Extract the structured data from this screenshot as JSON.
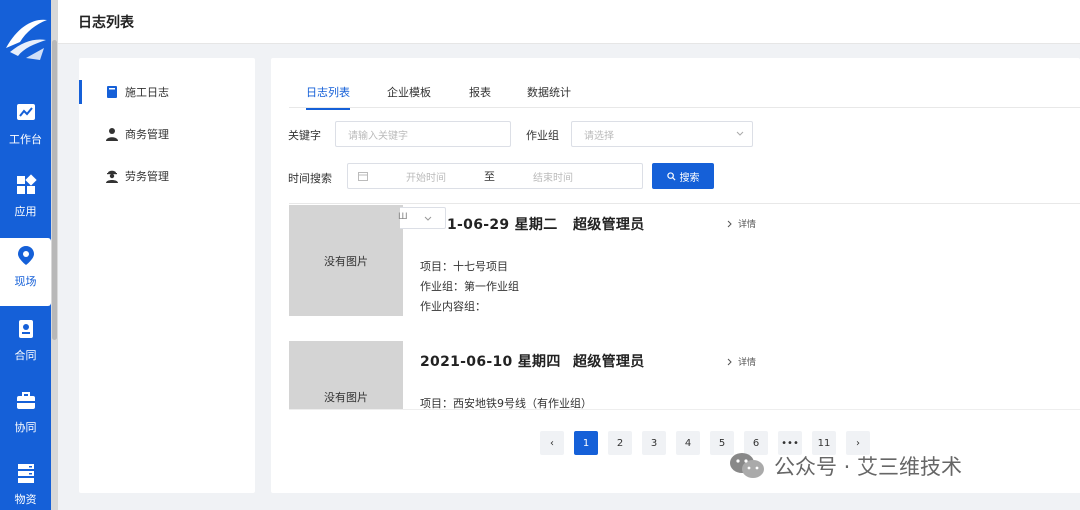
{
  "header": {
    "title": "日志列表"
  },
  "nav": {
    "items": [
      {
        "label": "工作台",
        "icon": "chart-icon"
      },
      {
        "label": "应用",
        "icon": "apps-icon"
      },
      {
        "label": "现场",
        "icon": "location-pin-icon"
      },
      {
        "label": "合同",
        "icon": "contract-icon"
      },
      {
        "label": "协同",
        "icon": "briefcase-icon"
      },
      {
        "label": "物资",
        "icon": "storage-icon"
      }
    ],
    "active": "现场"
  },
  "sidebar": {
    "items": [
      {
        "label": "施工日志",
        "icon": "book-icon"
      },
      {
        "label": "商务管理",
        "icon": "user-icon"
      },
      {
        "label": "劳务管理",
        "icon": "worker-icon"
      }
    ]
  },
  "tabs": [
    "日志列表",
    "企业模板",
    "报表",
    "数据统计"
  ],
  "filters": {
    "keyword_label": "关键字",
    "keyword_placeholder": "请输入关键字",
    "group_label": "作业组",
    "group_placeholder": "请选择",
    "time_label": "时间搜索",
    "start_placeholder": "开始时间",
    "to": "至",
    "end_placeholder": "结束时间",
    "search_button": "搜索"
  },
  "logs": [
    {
      "image": "没有图片",
      "select_fragment": "Ш",
      "date": "1-06-29  星期二",
      "user": "超级管理员",
      "detail": "详情",
      "project": "项目：十七号项目",
      "group": "作业组：第一作业组",
      "content": "作业内容组："
    },
    {
      "image": "没有图片",
      "date": "2021-06-10  星期四",
      "user": "超级管理员",
      "detail": "详情",
      "project": "项目：西安地铁9号线（有作业组）"
    }
  ],
  "pagination": {
    "prev": "‹",
    "pages": [
      "1",
      "2",
      "3",
      "4",
      "5",
      "6",
      "•••",
      "11"
    ],
    "next": "›",
    "current": "1"
  },
  "watermark": {
    "text": "公众号 · 艾三维技术"
  },
  "colors": {
    "primary": "#1560d8",
    "placeholder_bg": "#d4d4d4"
  }
}
